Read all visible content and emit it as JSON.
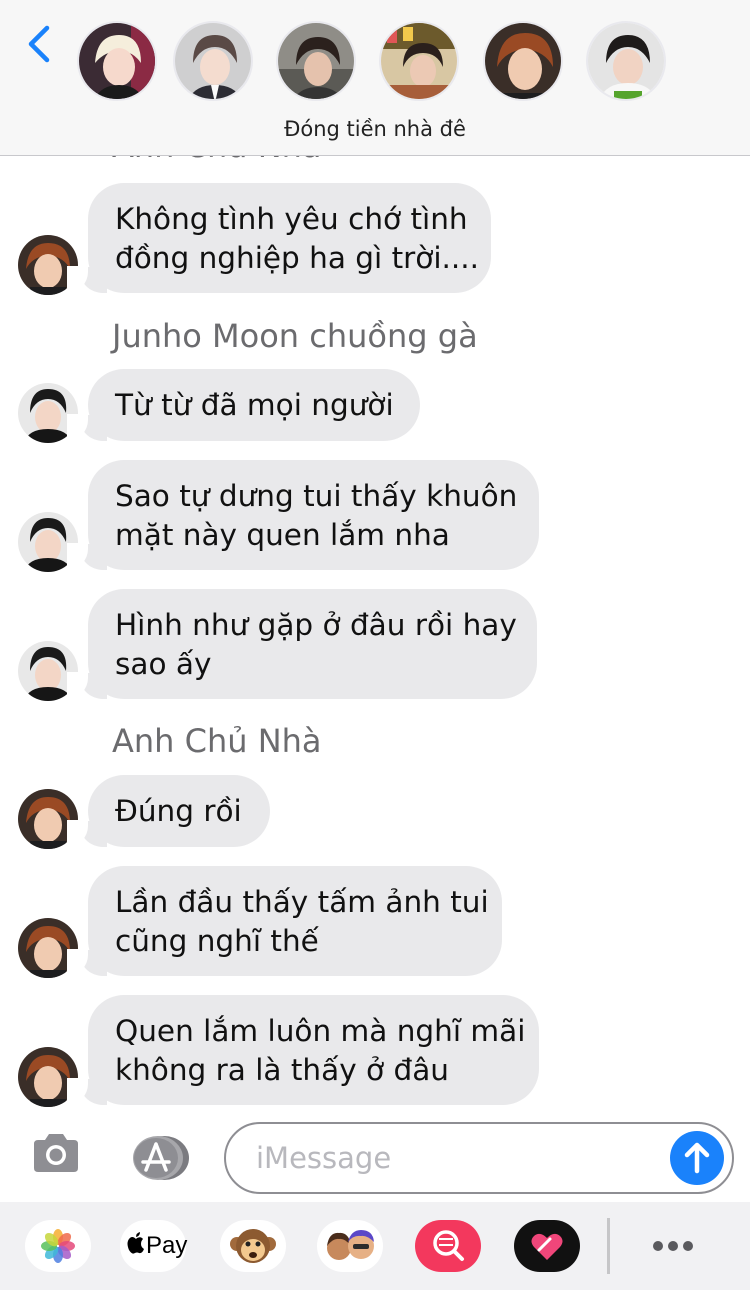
{
  "conversation": {
    "title": "Đóng tiền nhà đê"
  },
  "icons": {
    "back": "chevron-left-icon",
    "camera": "camera-icon",
    "app_store": "app-store-icon",
    "send": "arrow-up-icon"
  },
  "colors": {
    "accent": "#1a82fb",
    "bubble": "#e9e9eb",
    "sender": "#6b6b6e"
  },
  "messages": [
    {
      "sender_label": "Anh Chủ Nhà"
    },
    {
      "text_lines": [
        "Không tình yêu chớ tình",
        "đồng nghiệp ha gì trời...."
      ]
    },
    {
      "sender_label": "Junho Moon chuồng gà"
    },
    {
      "text_lines": [
        "Từ từ đã mọi người"
      ]
    },
    {
      "text_lines": [
        "Sao tự dưng tui thấy khuôn",
        "mặt này quen lắm nha"
      ]
    },
    {
      "text_lines": [
        "Hình như gặp ở đâu rồi hay",
        "sao ấy"
      ]
    },
    {
      "sender_label": "Anh Chủ Nhà"
    },
    {
      "text_lines": [
        "Đúng rồi"
      ]
    },
    {
      "text_lines": [
        "Lần đầu thấy tấm ảnh tui",
        "cũng nghĩ thế"
      ]
    },
    {
      "text_lines": [
        "Quen lắm luôn mà nghĩ mãi",
        "không ra là thấy ở đâu"
      ]
    }
  ],
  "composer": {
    "placeholder": "iMessage"
  },
  "app_drawer": {
    "apple_pay_label": "Pay",
    "apps": [
      "photos-app-icon",
      "apple-pay-icon",
      "animoji-icon",
      "memoji-icon",
      "search-images-icon",
      "digital-touch-icon",
      "more-icon"
    ]
  }
}
